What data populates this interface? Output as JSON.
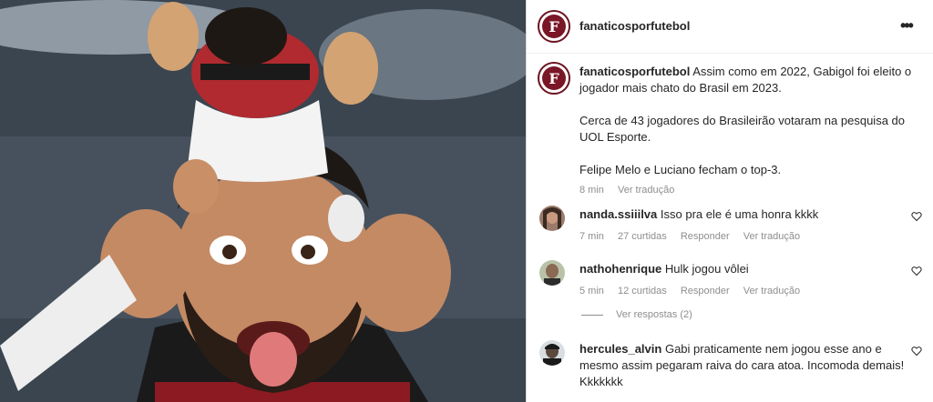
{
  "post": {
    "username": "fanaticosporfutebol",
    "logo_letter": "F",
    "more_icon": "•••",
    "caption": {
      "username": "fanaticosporfutebol",
      "line1": "Assim como em 2022, Gabigol foi eleito o jogador mais chato do Brasil em 2023.",
      "line2": "Cerca de 43 jogadores do Brasileirão votaram na pesquisa do UOL Esporte.",
      "line3": "Felipe Melo e Luciano fecham o top-3.",
      "time": "8 min",
      "translate": "Ver tradução"
    }
  },
  "comments": [
    {
      "username": "nanda.ssiiilva",
      "text": "Isso pra ele é uma honra kkkk",
      "time": "7 min",
      "likes": "27 curtidas",
      "reply": "Responder",
      "translate": "Ver tradução"
    },
    {
      "username": "nathohenrique",
      "text": "Hulk jogou vôlei",
      "time": "5 min",
      "likes": "12 curtidas",
      "reply": "Responder",
      "translate": "Ver tradução",
      "view_replies": "Ver respostas (2)"
    },
    {
      "username": "hercules_alvin",
      "text": "Gabi praticamente nem jogou esse ano e mesmo assim pegaram raiva do cara atoa. Incomoda demais! Kkkkkkk"
    }
  ],
  "icons": {
    "heart": "heart-outline-icon",
    "more": "more-options-icon"
  },
  "colors": {
    "logo_bg": "#7a1626",
    "muted": "#8e8e8e",
    "text": "#262626"
  }
}
